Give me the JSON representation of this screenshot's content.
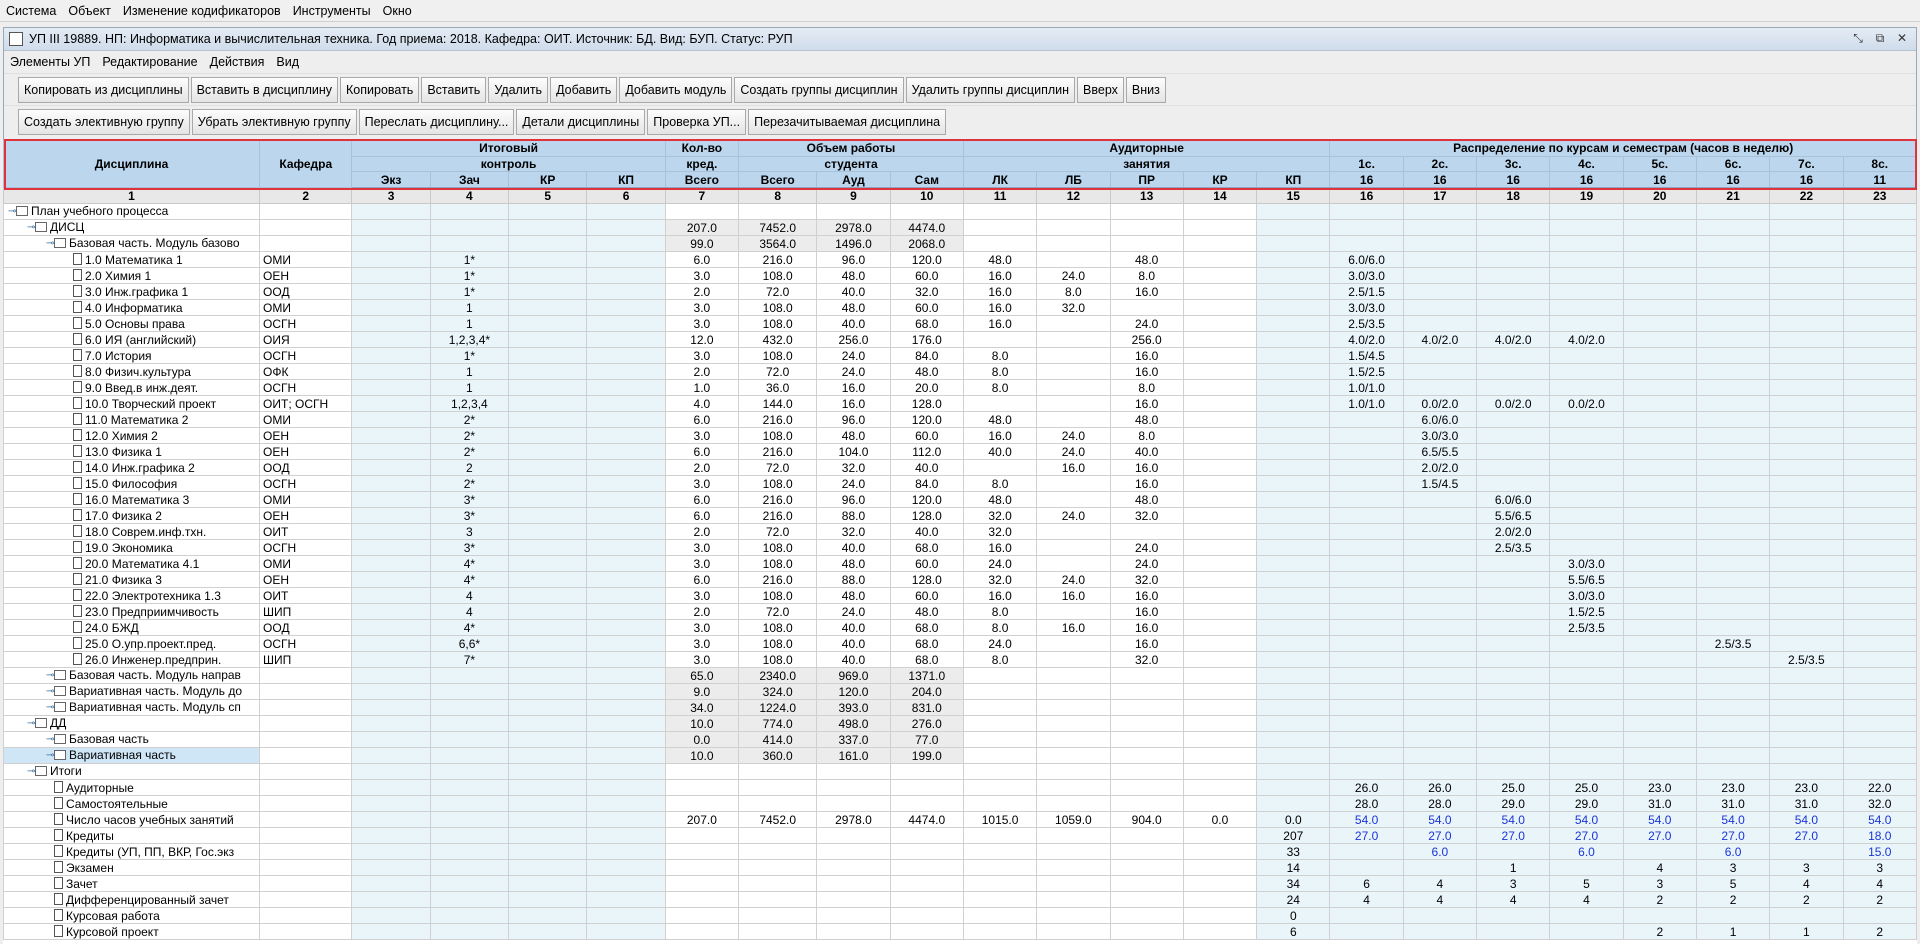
{
  "menubar": [
    "Система",
    "Объект",
    "Изменение кодификаторов",
    "Инструменты",
    "Окно"
  ],
  "window_title": "УП III 19889. НП: Информатика и вычислительная техника. Год приема: 2018. Кафедра: ОИТ. Источник: БД. Вид: БУП. Статус: РУП",
  "window_buttons": [
    "⤡",
    "⧉",
    "✕"
  ],
  "submenu": [
    "Элементы УП",
    "Редактирование",
    "Действия",
    "Вид"
  ],
  "toolbar1": [
    "Копировать из дисциплины",
    "Вставить в дисциплину",
    "Копировать",
    "Вставить",
    "Удалить",
    "Добавить",
    "Добавить модуль",
    "Создать группы дисциплин",
    "Удалить группы дисциплин",
    "Вверх",
    "Вниз"
  ],
  "toolbar2": [
    "Создать элективную группу",
    "Убрать элективную группу",
    "Переслать дисциплину...",
    "Детали дисциплины",
    "Проверка УП...",
    "Перезачитываемая дисциплина"
  ],
  "header": {
    "disc": "Дисциплина",
    "kaf": "Кафедра",
    "itog1": "Итоговый",
    "itog2": "контроль",
    "kred1": "Кол-во",
    "kred2": "кред.",
    "ob1": "Объем работы",
    "ob2": "студента",
    "aud1": "Аудиторные",
    "aud2": "занятия",
    "rasp": "Распределение по курсам и семестрам (часов в неделю)",
    "sub": [
      "Экз",
      "Зач",
      "КР",
      "КП",
      "Всего",
      "Всего",
      "Ауд",
      "Сам",
      "ЛК",
      "ЛБ",
      "ПР",
      "КР",
      "КП"
    ],
    "courses": [
      "1с.",
      "2с.",
      "3с.",
      "4с.",
      "5с.",
      "6с.",
      "7с.",
      "8с."
    ],
    "weeks": [
      "16",
      "16",
      "16",
      "16",
      "16",
      "16",
      "16",
      "11"
    ],
    "numbers": [
      "1",
      "2",
      "3",
      "4",
      "5",
      "6",
      "7",
      "8",
      "9",
      "10",
      "11",
      "12",
      "13",
      "14",
      "15",
      "16",
      "17",
      "18",
      "19",
      "20",
      "21",
      "22",
      "23"
    ]
  },
  "rows": [
    {
      "lvl": 0,
      "icon": "folder",
      "name": "План учебного процесса",
      "c": []
    },
    {
      "lvl": 1,
      "icon": "folderkey",
      "name": "ДИСЦ",
      "grp": 1,
      "c": [
        "",
        "",
        "",
        "",
        "",
        "207.0",
        "7452.0",
        "2978.0",
        "4474.0"
      ]
    },
    {
      "lvl": 2,
      "icon": "folderkey",
      "name": "Базовая часть. Модуль базово",
      "grp": 1,
      "c": [
        "",
        "",
        "",
        "",
        "",
        "99.0",
        "3564.0",
        "1496.0",
        "2068.0"
      ]
    },
    {
      "lvl": 3,
      "icon": "page",
      "name": "1.0 Математика 1",
      "c": [
        "ОМИ",
        "",
        "1*",
        "",
        "",
        "6.0",
        "216.0",
        "96.0",
        "120.0",
        "48.0",
        "",
        "48.0",
        "",
        "",
        "6.0/6.0"
      ]
    },
    {
      "lvl": 3,
      "icon": "page",
      "name": "2.0 Химия 1",
      "c": [
        "ОЕН",
        "",
        "1*",
        "",
        "",
        "3.0",
        "108.0",
        "48.0",
        "60.0",
        "16.0",
        "24.0",
        "8.0",
        "",
        "",
        "3.0/3.0"
      ]
    },
    {
      "lvl": 3,
      "icon": "page",
      "name": "3.0 Инж.графика 1",
      "c": [
        "ООД",
        "",
        "1*",
        "",
        "",
        "2.0",
        "72.0",
        "40.0",
        "32.0",
        "16.0",
        "8.0",
        "16.0",
        "",
        "",
        "2.5/1.5"
      ]
    },
    {
      "lvl": 3,
      "icon": "page",
      "name": "4.0 Информатика",
      "c": [
        "ОМИ",
        "",
        "1",
        "",
        "",
        "3.0",
        "108.0",
        "48.0",
        "60.0",
        "16.0",
        "32.0",
        "",
        "",
        "",
        "3.0/3.0"
      ]
    },
    {
      "lvl": 3,
      "icon": "page",
      "name": "5.0 Основы права",
      "c": [
        "ОСГН",
        "",
        "1",
        "",
        "",
        "3.0",
        "108.0",
        "40.0",
        "68.0",
        "16.0",
        "",
        "24.0",
        "",
        "",
        "2.5/3.5"
      ]
    },
    {
      "lvl": 3,
      "icon": "page",
      "name": "6.0 ИЯ (английский)",
      "c": [
        "ОИЯ",
        "",
        "1,2,3,4*",
        "",
        "",
        "12.0",
        "432.0",
        "256.0",
        "176.0",
        "",
        "",
        "256.0",
        "",
        "",
        "4.0/2.0",
        "4.0/2.0",
        "4.0/2.0",
        "4.0/2.0"
      ]
    },
    {
      "lvl": 3,
      "icon": "page",
      "name": "7.0 История",
      "c": [
        "ОСГН",
        "",
        "1*",
        "",
        "",
        "3.0",
        "108.0",
        "24.0",
        "84.0",
        "8.0",
        "",
        "16.0",
        "",
        "",
        "1.5/4.5"
      ]
    },
    {
      "lvl": 3,
      "icon": "page",
      "name": "8.0 Физич.культура",
      "c": [
        "ОФК",
        "",
        "1",
        "",
        "",
        "2.0",
        "72.0",
        "24.0",
        "48.0",
        "8.0",
        "",
        "16.0",
        "",
        "",
        "1.5/2.5"
      ]
    },
    {
      "lvl": 3,
      "icon": "page",
      "name": "9.0 Введ.в инж.деят.",
      "c": [
        "ОСГН",
        "",
        "1",
        "",
        "",
        "1.0",
        "36.0",
        "16.0",
        "20.0",
        "8.0",
        "",
        "8.0",
        "",
        "",
        "1.0/1.0"
      ]
    },
    {
      "lvl": 3,
      "icon": "page",
      "name": "10.0 Творческий проект",
      "c": [
        "ОИТ; ОСГН",
        "",
        "1,2,3,4",
        "",
        "",
        "4.0",
        "144.0",
        "16.0",
        "128.0",
        "",
        "",
        "16.0",
        "",
        "",
        "1.0/1.0",
        "0.0/2.0",
        "0.0/2.0",
        "0.0/2.0"
      ]
    },
    {
      "lvl": 3,
      "icon": "page",
      "name": "11.0 Математика 2",
      "c": [
        "ОМИ",
        "",
        "2*",
        "",
        "",
        "6.0",
        "216.0",
        "96.0",
        "120.0",
        "48.0",
        "",
        "48.0",
        "",
        "",
        "",
        "6.0/6.0"
      ]
    },
    {
      "lvl": 3,
      "icon": "page",
      "name": "12.0 Химия 2",
      "c": [
        "ОЕН",
        "",
        "2*",
        "",
        "",
        "3.0",
        "108.0",
        "48.0",
        "60.0",
        "16.0",
        "24.0",
        "8.0",
        "",
        "",
        "",
        "3.0/3.0"
      ]
    },
    {
      "lvl": 3,
      "icon": "page",
      "name": "13.0 Физика 1",
      "c": [
        "ОЕН",
        "",
        "2*",
        "",
        "",
        "6.0",
        "216.0",
        "104.0",
        "112.0",
        "40.0",
        "24.0",
        "40.0",
        "",
        "",
        "",
        "6.5/5.5"
      ]
    },
    {
      "lvl": 3,
      "icon": "page",
      "name": "14.0 Инж.графика 2",
      "c": [
        "ООД",
        "",
        "2",
        "",
        "",
        "2.0",
        "72.0",
        "32.0",
        "40.0",
        "",
        "16.0",
        "16.0",
        "",
        "",
        "",
        "2.0/2.0"
      ]
    },
    {
      "lvl": 3,
      "icon": "page",
      "name": "15.0 Философия",
      "c": [
        "ОСГН",
        "",
        "2*",
        "",
        "",
        "3.0",
        "108.0",
        "24.0",
        "84.0",
        "8.0",
        "",
        "16.0",
        "",
        "",
        "",
        "1.5/4.5"
      ]
    },
    {
      "lvl": 3,
      "icon": "page",
      "name": "16.0 Математика 3",
      "c": [
        "ОМИ",
        "",
        "3*",
        "",
        "",
        "6.0",
        "216.0",
        "96.0",
        "120.0",
        "48.0",
        "",
        "48.0",
        "",
        "",
        "",
        "",
        "6.0/6.0"
      ]
    },
    {
      "lvl": 3,
      "icon": "page",
      "name": "17.0 Физика 2",
      "c": [
        "ОЕН",
        "",
        "3*",
        "",
        "",
        "6.0",
        "216.0",
        "88.0",
        "128.0",
        "32.0",
        "24.0",
        "32.0",
        "",
        "",
        "",
        "",
        "5.5/6.5"
      ]
    },
    {
      "lvl": 3,
      "icon": "page",
      "name": "18.0 Соврем.инф.тхн.",
      "c": [
        "ОИТ",
        "",
        "3",
        "",
        "",
        "2.0",
        "72.0",
        "32.0",
        "40.0",
        "32.0",
        "",
        "",
        "",
        "",
        "",
        "",
        "2.0/2.0"
      ]
    },
    {
      "lvl": 3,
      "icon": "page",
      "name": "19.0 Экономика",
      "c": [
        "ОСГН",
        "",
        "3*",
        "",
        "",
        "3.0",
        "108.0",
        "40.0",
        "68.0",
        "16.0",
        "",
        "24.0",
        "",
        "",
        "",
        "",
        "2.5/3.5"
      ]
    },
    {
      "lvl": 3,
      "icon": "page",
      "name": "20.0 Математика 4.1",
      "c": [
        "ОМИ",
        "",
        "4*",
        "",
        "",
        "3.0",
        "108.0",
        "48.0",
        "60.0",
        "24.0",
        "",
        "24.0",
        "",
        "",
        "",
        "",
        "",
        "3.0/3.0"
      ]
    },
    {
      "lvl": 3,
      "icon": "page",
      "name": "21.0 Физика 3",
      "c": [
        "ОЕН",
        "",
        "4*",
        "",
        "",
        "6.0",
        "216.0",
        "88.0",
        "128.0",
        "32.0",
        "24.0",
        "32.0",
        "",
        "",
        "",
        "",
        "",
        "5.5/6.5"
      ]
    },
    {
      "lvl": 3,
      "icon": "page",
      "name": "22.0 Электротехника 1.3",
      "c": [
        "ОИТ",
        "",
        "4",
        "",
        "",
        "3.0",
        "108.0",
        "48.0",
        "60.0",
        "16.0",
        "16.0",
        "16.0",
        "",
        "",
        "",
        "",
        "",
        "3.0/3.0"
      ]
    },
    {
      "lvl": 3,
      "icon": "page",
      "name": "23.0 Предприимчивость",
      "c": [
        "ШИП",
        "",
        "4",
        "",
        "",
        "2.0",
        "72.0",
        "24.0",
        "48.0",
        "8.0",
        "",
        "16.0",
        "",
        "",
        "",
        "",
        "",
        "1.5/2.5"
      ]
    },
    {
      "lvl": 3,
      "icon": "page",
      "name": "24.0 БЖД",
      "c": [
        "ООД",
        "",
        "4*",
        "",
        "",
        "3.0",
        "108.0",
        "40.0",
        "68.0",
        "8.0",
        "16.0",
        "16.0",
        "",
        "",
        "",
        "",
        "",
        "2.5/3.5"
      ]
    },
    {
      "lvl": 3,
      "icon": "page",
      "name": "25.0 О.упр.проект.пред.",
      "c": [
        "ОСГН",
        "",
        "6,6*",
        "",
        "",
        "3.0",
        "108.0",
        "40.0",
        "68.0",
        "24.0",
        "",
        "16.0",
        "",
        "",
        "",
        "",
        "",
        "",
        "",
        "2.5/3.5"
      ]
    },
    {
      "lvl": 3,
      "icon": "page",
      "name": "26.0 Инженер.предприн.",
      "c": [
        "ШИП",
        "",
        "7*",
        "",
        "",
        "3.0",
        "108.0",
        "40.0",
        "68.0",
        "8.0",
        "",
        "32.0",
        "",
        "",
        "",
        "",
        "",
        "",
        "",
        "",
        "2.5/3.5"
      ]
    },
    {
      "lvl": 2,
      "icon": "folderkey",
      "name": "Базовая часть. Модуль направ",
      "grp": 1,
      "c": [
        "",
        "",
        "",
        "",
        "",
        "65.0",
        "2340.0",
        "969.0",
        "1371.0"
      ]
    },
    {
      "lvl": 2,
      "icon": "folderkey",
      "name": "Вариативная часть. Модуль до",
      "grp": 1,
      "c": [
        "",
        "",
        "",
        "",
        "",
        "9.0",
        "324.0",
        "120.0",
        "204.0"
      ]
    },
    {
      "lvl": 2,
      "icon": "folderkey",
      "name": "Вариативная часть. Модуль сп",
      "grp": 1,
      "c": [
        "",
        "",
        "",
        "",
        "",
        "34.0",
        "1224.0",
        "393.0",
        "831.0"
      ]
    },
    {
      "lvl": 1,
      "icon": "folderkey",
      "name": "ДД",
      "grp": 1,
      "c": [
        "",
        "",
        "",
        "",
        "",
        "10.0",
        "774.0",
        "498.0",
        "276.0"
      ]
    },
    {
      "lvl": 2,
      "icon": "folderkey",
      "name": "Базовая часть",
      "grp": 1,
      "c": [
        "",
        "",
        "",
        "",
        "",
        "0.0",
        "414.0",
        "337.0",
        "77.0"
      ]
    },
    {
      "lvl": 2,
      "icon": "folderkey",
      "name": "Вариативная часть",
      "grp": 1,
      "sel": 1,
      "c": [
        "",
        "",
        "",
        "",
        "",
        "10.0",
        "360.0",
        "161.0",
        "199.0"
      ]
    },
    {
      "lvl": 1,
      "icon": "folder",
      "name": "Итоги",
      "c": []
    },
    {
      "lvl": 2,
      "icon": "page",
      "name": "Аудиторные",
      "c": [
        "",
        "",
        "",
        "",
        "",
        "",
        "",
        "",
        "",
        "",
        "",
        "",
        "",
        "",
        "26.0",
        "26.0",
        "25.0",
        "25.0",
        "23.0",
        "23.0",
        "23.0",
        "22.0"
      ]
    },
    {
      "lvl": 2,
      "icon": "page",
      "name": "Самостоятельные",
      "c": [
        "",
        "",
        "",
        "",
        "",
        "",
        "",
        "",
        "",
        "",
        "",
        "",
        "",
        "",
        "28.0",
        "28.0",
        "29.0",
        "29.0",
        "31.0",
        "31.0",
        "31.0",
        "32.0"
      ]
    },
    {
      "lvl": 2,
      "icon": "page",
      "name": "Число часов учебных занятий",
      "blue": 1,
      "c": [
        "",
        "",
        "",
        "",
        "",
        "207.0",
        "7452.0",
        "2978.0",
        "4474.0",
        "1015.0",
        "1059.0",
        "904.0",
        "0.0",
        "0.0",
        "54.0",
        "54.0",
        "54.0",
        "54.0",
        "54.0",
        "54.0",
        "54.0",
        "54.0"
      ]
    },
    {
      "lvl": 2,
      "icon": "page",
      "name": "Кредиты",
      "blue": 1,
      "c": [
        "",
        "",
        "",
        "",
        "",
        "",
        "",
        "",
        "",
        "",
        "",
        "",
        "",
        "207",
        "27.0",
        "27.0",
        "27.0",
        "27.0",
        "27.0",
        "27.0",
        "27.0",
        "18.0"
      ]
    },
    {
      "lvl": 2,
      "icon": "page",
      "name": "Кредиты (УП, ПП, ВКР, Гос.экз",
      "blue": 1,
      "c": [
        "",
        "",
        "",
        "",
        "",
        "",
        "",
        "",
        "",
        "",
        "",
        "",
        "",
        "33",
        "",
        "6.0",
        "",
        "6.0",
        "",
        "6.0",
        "",
        "15.0"
      ]
    },
    {
      "lvl": 2,
      "icon": "page",
      "name": "Экзамен",
      "c": [
        "",
        "",
        "",
        "",
        "",
        "",
        "",
        "",
        "",
        "",
        "",
        "",
        "",
        "14",
        "",
        "",
        "1",
        "",
        "4",
        "3",
        "3",
        "3"
      ]
    },
    {
      "lvl": 2,
      "icon": "page",
      "name": "Зачет",
      "c": [
        "",
        "",
        "",
        "",
        "",
        "",
        "",
        "",
        "",
        "",
        "",
        "",
        "",
        "34",
        "6",
        "4",
        "3",
        "5",
        "3",
        "5",
        "4",
        "4"
      ]
    },
    {
      "lvl": 2,
      "icon": "page",
      "name": "Дифференцированный зачет",
      "c": [
        "",
        "",
        "",
        "",
        "",
        "",
        "",
        "",
        "",
        "",
        "",
        "",
        "",
        "24",
        "4",
        "4",
        "4",
        "4",
        "2",
        "2",
        "2",
        "2"
      ]
    },
    {
      "lvl": 2,
      "icon": "page",
      "name": "Курсовая работа",
      "c": [
        "",
        "",
        "",
        "",
        "",
        "",
        "",
        "",
        "",
        "",
        "",
        "",
        "",
        "0"
      ]
    },
    {
      "lvl": 2,
      "icon": "page",
      "name": "Курсовой проект",
      "c": [
        "",
        "",
        "",
        "",
        "",
        "",
        "",
        "",
        "",
        "",
        "",
        "",
        "",
        "6",
        "",
        "",
        "",
        "",
        "2",
        "1",
        "1",
        "2"
      ]
    }
  ]
}
